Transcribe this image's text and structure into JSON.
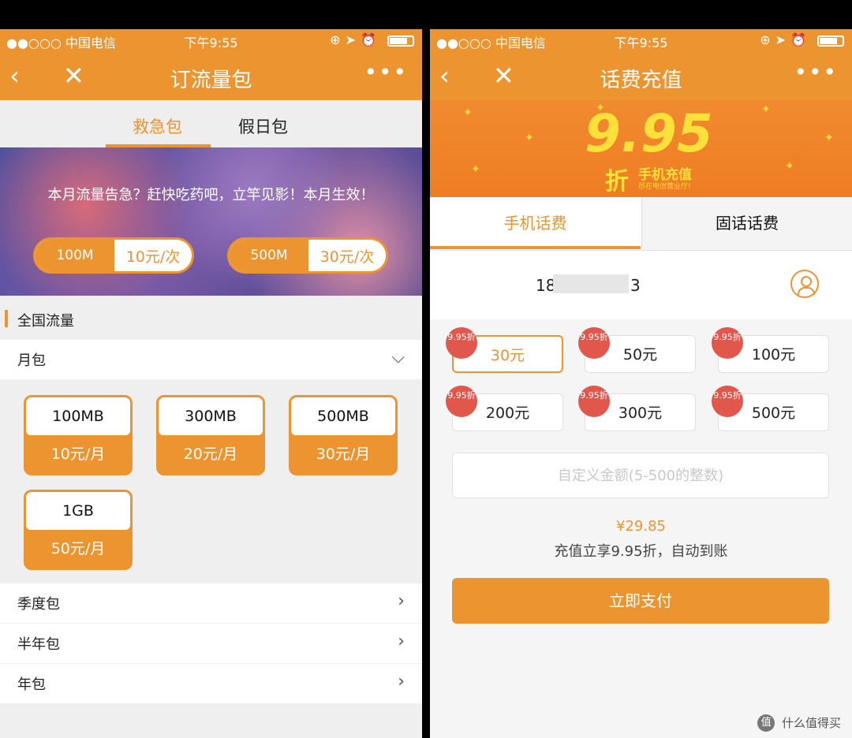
{
  "status_bar": {
    "carrier": "●●○○○ 中国电信",
    "time": "下午9:55"
  },
  "left": {
    "nav": {
      "back_icon": "‹",
      "close_icon": "✕",
      "title": "订流量包",
      "more_icon": "•••"
    },
    "tabs": [
      {
        "label": "救急包",
        "active": true
      },
      {
        "label": "假日包",
        "active": false
      }
    ],
    "banner": {
      "slogan": "本月流量告急？赶快吃药吧，立竿见影！本月生效！",
      "options": [
        {
          "size": "100M",
          "price": "10元/次"
        },
        {
          "size": "500M",
          "price": "30元/次"
        }
      ]
    },
    "section_title": "全国流量",
    "monthly": {
      "label": "月包",
      "chevron": "⌵"
    },
    "packages": [
      {
        "name": "100MB",
        "price": "10元/月"
      },
      {
        "name": "300MB",
        "price": "20元/月"
      },
      {
        "name": "500MB",
        "price": "30元/月"
      },
      {
        "name": "1GB",
        "price": "50元/月"
      }
    ],
    "rows": [
      {
        "label": "季度包"
      },
      {
        "label": "半年包"
      },
      {
        "label": "年包"
      }
    ],
    "chevron_right": "›"
  },
  "right": {
    "nav": {
      "back_icon": "‹",
      "close_icon": "✕",
      "title": "话费充值",
      "more_icon": "•••"
    },
    "promo": {
      "big": "9.95",
      "zhe": "折",
      "sub": "手机充值",
      "sub2": "尽在电信营业厅!"
    },
    "tabs": [
      {
        "label": "手机话费",
        "active": true
      },
      {
        "label": "固话话费",
        "active": false
      }
    ],
    "phone": {
      "prefix": "18",
      "suffix": "3"
    },
    "badge_text": "9.95折",
    "amounts": [
      "30元",
      "50元",
      "100元",
      "200元",
      "300元",
      "500元"
    ],
    "custom_placeholder": "自定义金额(5-500的整数)",
    "total": "¥29.85",
    "note": "充值立享9.95折，自动到账",
    "pay_label": "立即支付"
  },
  "watermark": {
    "icon": "值",
    "text": "什么值得买"
  },
  "colors": {
    "accent": "#ec942f",
    "badge": "#e2574c"
  }
}
